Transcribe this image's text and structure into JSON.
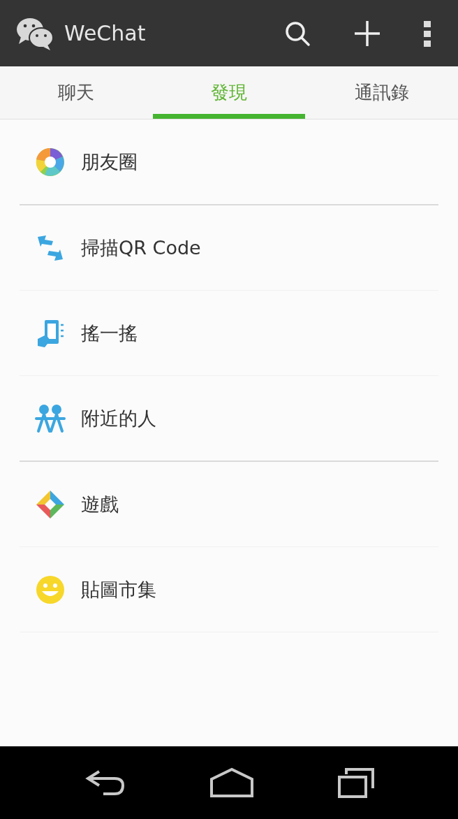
{
  "app_bar": {
    "title": "WeChat"
  },
  "tabs": [
    {
      "label": "聊天",
      "selected": false
    },
    {
      "label": "發現",
      "selected": true
    },
    {
      "label": "通訊錄",
      "selected": false
    }
  ],
  "groups": [
    [
      {
        "label": "朋友圈"
      }
    ],
    [
      {
        "label": "掃描QR Code"
      },
      {
        "label": "搖一搖"
      },
      {
        "label": "附近的人"
      }
    ],
    [
      {
        "label": "遊戲"
      },
      {
        "label": "貼圖市集"
      }
    ]
  ]
}
